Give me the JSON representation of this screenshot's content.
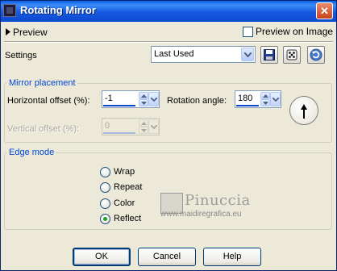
{
  "window": {
    "title": "Rotating Mirror",
    "close_glyph": "✕"
  },
  "preview": {
    "label": "Preview",
    "preview_on_image": "Preview on Image",
    "preview_on_image_checked": false
  },
  "settings": {
    "label": "Settings",
    "preset_value": "Last Used",
    "icons": [
      "save-preset-icon",
      "randomize-dice-icon",
      "reset-icon"
    ]
  },
  "mirror_placement": {
    "title": "Mirror placement",
    "horizontal_offset_label": "Horizontal offset (%):",
    "horizontal_offset_value": "-1",
    "rotation_angle_label": "Rotation angle:",
    "rotation_angle_value": "180",
    "vertical_offset_label": "Vertical offset (%):",
    "vertical_offset_value": "0"
  },
  "edge_mode": {
    "title": "Edge mode",
    "options": [
      {
        "label": "Wrap",
        "selected": false
      },
      {
        "label": "Repeat",
        "selected": false
      },
      {
        "label": "Color",
        "selected": false
      },
      {
        "label": "Reflect",
        "selected": true
      }
    ]
  },
  "watermark": {
    "name": "Pinuccia",
    "url": "www.maidiregrafica.eu"
  },
  "buttons": {
    "ok": "OK",
    "cancel": "Cancel",
    "help": "Help"
  },
  "colors": {
    "title_bar": "#0b4ad0",
    "group_title": "#0046d5",
    "dialog_bg": "#ece9d8"
  }
}
